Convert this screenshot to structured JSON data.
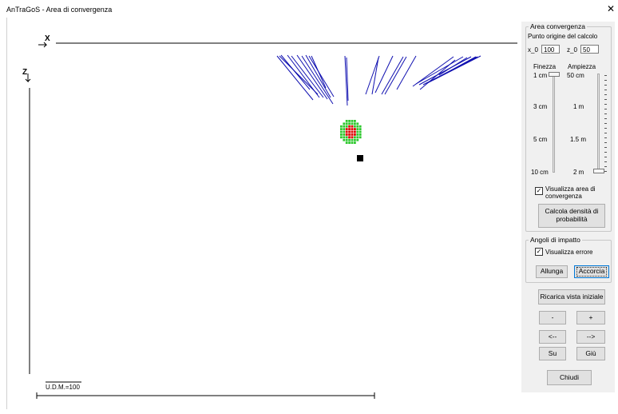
{
  "window": {
    "title": "AnTraGoS - Area di convergenza",
    "close_symbol": "✕"
  },
  "plot": {
    "axis_x_label": "X",
    "axis_z_label": "Z",
    "scale_label": "U.D.M.=100",
    "trajectory_color": "#1010b0",
    "origin_marker_color": "#000000",
    "density_colors": {
      "high": "#e00000",
      "medium": "#2ec82e",
      "outline": "#66e000"
    }
  },
  "panel": {
    "convergence_group": {
      "title": "Area convergenza",
      "origin_label": "Punto origine del calcolo",
      "x0_label": "x_0",
      "x0_value": "100",
      "z0_label": "z_0",
      "z0_value": "50",
      "finezza_label": "Finezza",
      "ampiezza_label": "Ampiezza",
      "finezza_ticks": [
        "1 cm",
        "3 cm",
        "5 cm",
        "10 cm"
      ],
      "ampiezza_ticks": [
        "50 cm",
        "1 m",
        "1.5 m",
        "2 m"
      ],
      "show_area_label": "Visualizza area di convergenza",
      "show_area_checked": true,
      "calc_button_label": "Calcola densità di probabilità"
    },
    "impact_group": {
      "title": "Angoli di impatto",
      "show_error_label": "Visualizza errore",
      "show_error_checked": true,
      "lengthen_label": "Allunga",
      "shorten_label": "Accorcia"
    },
    "reload_label": "Ricarica vista iniziale",
    "zoom_out_label": "-",
    "zoom_in_label": "+",
    "left_label": "<--",
    "right_label": "-->",
    "up_label": "Su",
    "down_label": "Giù",
    "close_label": "Chiudi"
  }
}
